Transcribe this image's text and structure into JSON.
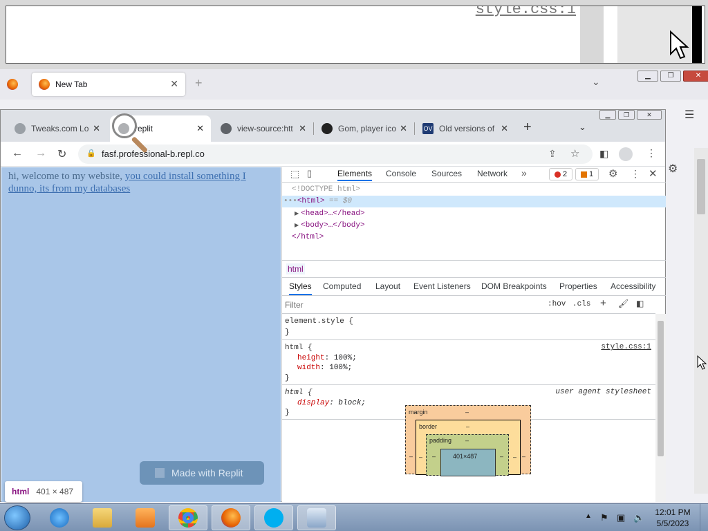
{
  "zoom_overlay": {
    "text": "style.css:1"
  },
  "firefox": {
    "tab_label": "New Tab",
    "tab_close": "✕",
    "new_tab": "+",
    "list_tabs": "⌄",
    "menu": "☰",
    "win_min": "▁",
    "win_max": "❐",
    "win_close": "✕",
    "gear": "⚙"
  },
  "chrome": {
    "tabs": [
      {
        "label": "Tweaks.com Lo",
        "close": "✕"
      },
      {
        "label": "replit",
        "close": "✕"
      },
      {
        "label": "view-source:htt",
        "close": "✕"
      },
      {
        "label": "Gom, player ico",
        "close": "✕"
      },
      {
        "label": "Old versions of",
        "close": "✕",
        "favicon_text": "OV"
      }
    ],
    "new_tab": "+",
    "tab_list": "⌄",
    "win_min": "▁",
    "win_max": "❐",
    "win_close": "✕",
    "back": "←",
    "forward": "→",
    "reload": "↻",
    "lock": "🔒",
    "url": "fasf.professional-b.repl.co",
    "share": "⇪",
    "star": "☆",
    "side_panel": "◧",
    "kebab": "⋮"
  },
  "page": {
    "text_plain": "hi, welcome to my website, ",
    "link_text": "you could install something I dunno, its from my databases",
    "badge": "Made with Replit",
    "tooltip_tag": "html",
    "tooltip_size": "401 × 487"
  },
  "devtools": {
    "inspect": "⬚",
    "device": "▯",
    "tabs": [
      "Elements",
      "Console",
      "Sources",
      "Network"
    ],
    "more": "»",
    "errors": "2",
    "warnings": "1",
    "gear": "⚙",
    "kebab": "⋮",
    "close": "✕",
    "dom": {
      "doctype": "<!DOCTYPE html>",
      "dots": "•••",
      "html_open": "<html>",
      "sel_marker": " == $0",
      "head": "<head>…</head>",
      "body": "<body>…</body>",
      "html_close": "</html>"
    },
    "breadcrumb": "html",
    "sub_tabs": [
      "Styles",
      "Computed",
      "Layout",
      "Event Listeners",
      "DOM Breakpoints",
      "Properties",
      "Accessibility"
    ],
    "filter_placeholder": "Filter",
    "hov": ":hov",
    "cls": ".cls",
    "plus": "+",
    "paint": "🖌",
    "toggle": "◧",
    "rules": {
      "element_style_open": "element.style {",
      "close_brace": "}",
      "html_open": "html {",
      "html_source": "style.css:1",
      "prop_height": "height",
      "val_height": "100%;",
      "prop_width": "width",
      "val_width": "100%;",
      "ua_open": "html {",
      "ua_source": "user agent stylesheet",
      "prop_display": "display",
      "val_display": "block;"
    },
    "box_model": {
      "margin": "margin",
      "border": "border",
      "padding": "padding",
      "dash": "–",
      "content": "401×487"
    }
  },
  "taskbar": {
    "time": "12:01 PM",
    "date": "5/5/2023",
    "tray_arrow": "▲",
    "flag": "⚑",
    "network": "▣",
    "volume": "🔈"
  }
}
